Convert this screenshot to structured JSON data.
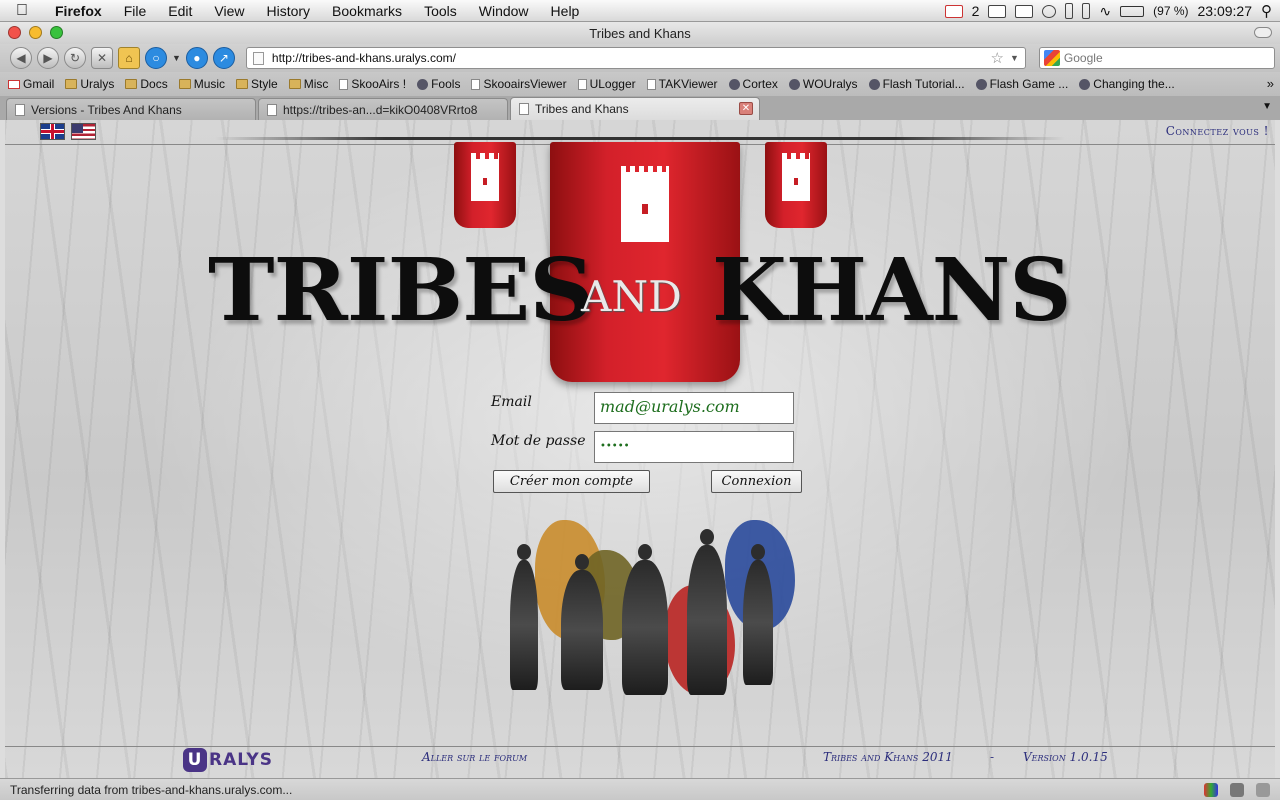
{
  "menubar": {
    "app": "Firefox",
    "items": [
      "File",
      "Edit",
      "View",
      "History",
      "Bookmarks",
      "Tools",
      "Window",
      "Help"
    ],
    "mail_count": "2",
    "battery": "(97 %)",
    "clock": "23:09:27"
  },
  "window": {
    "title": "Tribes and Khans"
  },
  "navbar": {
    "url": "http://tribes-and-khans.uralys.com/",
    "search_placeholder": "Google"
  },
  "bookmarks": [
    {
      "label": "Gmail",
      "icon": "gmail-icon"
    },
    {
      "label": "Uralys",
      "icon": "folder-icon"
    },
    {
      "label": "Docs",
      "icon": "folder-icon"
    },
    {
      "label": "Music",
      "icon": "folder-icon"
    },
    {
      "label": "Style",
      "icon": "folder-icon"
    },
    {
      "label": "Misc",
      "icon": "folder-icon"
    },
    {
      "label": "SkooAirs !",
      "icon": "page-icon"
    },
    {
      "label": "Fools",
      "icon": "site-icon"
    },
    {
      "label": "SkooairsViewer",
      "icon": "page-icon"
    },
    {
      "label": "ULogger",
      "icon": "page-icon"
    },
    {
      "label": "TAKViewer",
      "icon": "page-icon"
    },
    {
      "label": "Cortex",
      "icon": "site-icon"
    },
    {
      "label": "WOUralys",
      "icon": "site-icon"
    },
    {
      "label": "Flash Tutorial...",
      "icon": "site-icon"
    },
    {
      "label": "Flash Game ...",
      "icon": "site-icon"
    },
    {
      "label": "Changing the...",
      "icon": "site-icon"
    }
  ],
  "tabs": [
    {
      "label": "Versions - Tribes And Khans",
      "active": false
    },
    {
      "label": "https://tribes-an...d=kikO0408VRrto8",
      "active": false
    },
    {
      "label": "Tribes and Khans",
      "active": true
    }
  ],
  "page": {
    "login_link": "Connectez vous !",
    "logo": {
      "left": "TRIBES",
      "middle": "AND",
      "right": "KHANS"
    },
    "form": {
      "email_label": "Email",
      "email_value": "mad@uralys.com",
      "password_label": "Mot de passe",
      "password_value": "•••••",
      "create_button": "Créer mon compte",
      "login_button": "Connexion"
    },
    "footer": {
      "brand": "RALYS",
      "brand_letter": "U",
      "forum_link": "Aller sur le forum",
      "game_name": "Tribes and Khans 2011",
      "separator": "-",
      "version": "Version 1.0.15"
    }
  },
  "statusbar": {
    "text": "Transferring data from tribes-and-khans.uralys.com..."
  },
  "colors": {
    "accent_red": "#d3202a",
    "link_blue": "#2b2d7c",
    "brand_purple": "#4a3486"
  }
}
